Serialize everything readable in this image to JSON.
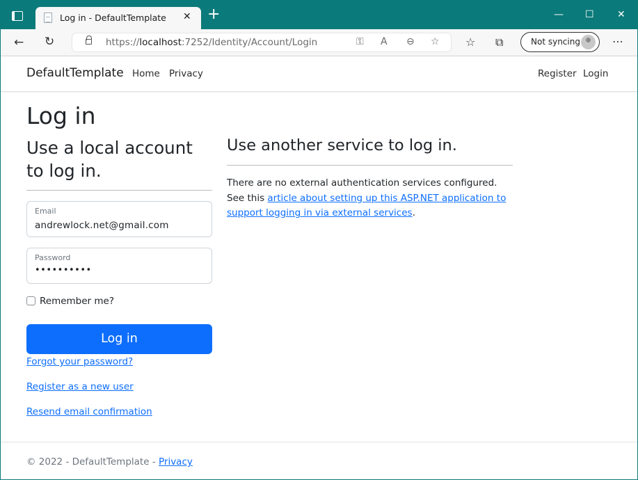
{
  "browser": {
    "tab_title": "Log in - DefaultTemplate",
    "tab_close": "✕",
    "new_tab": "+",
    "url_prefix": "https://",
    "url_host": "localhost",
    "url_rest": ":7252/Identity/Account/Login",
    "sync_label": "Not syncing",
    "minimize": "—",
    "maximize": "☐",
    "close": "✕"
  },
  "nav": {
    "brand": "DefaultTemplate",
    "home": "Home",
    "privacy": "Privacy",
    "register": "Register",
    "login": "Login"
  },
  "page": {
    "title": "Log in",
    "local_heading": "Use a local account to log in.",
    "email_label": "Email",
    "email_value": "andrewlock.net@gmail.com",
    "password_label": "Password",
    "password_value": "••••••••••",
    "remember_label": "Remember me?",
    "login_button": "Log in",
    "forgot_link": "Forgot your password?",
    "register_link": "Register as a new user",
    "resend_link": "Resend email confirmation",
    "external_heading": "Use another service to log in.",
    "external_text_before": "There are no external authentication services configured. See this ",
    "external_link": "article about setting up this ASP.NET application to support logging in via external services",
    "external_text_after": "."
  },
  "footer": {
    "text": "© 2022 - DefaultTemplate - ",
    "privacy_link": "Privacy"
  },
  "colors": {
    "titlebar": "#0b7a7a",
    "primary": "#0d6efd"
  }
}
